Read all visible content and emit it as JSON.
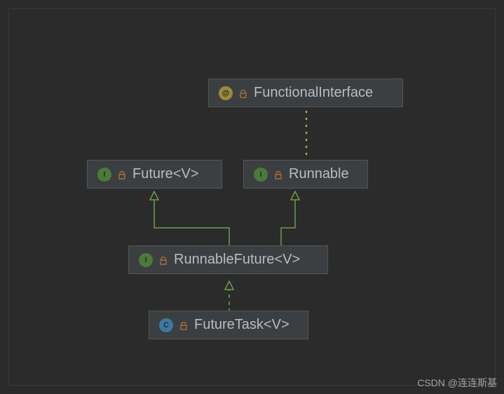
{
  "diagram": {
    "nodes": {
      "functionalInterface": {
        "label": "FunctionalInterface",
        "kind": "annotation"
      },
      "future": {
        "label": "Future<V>",
        "kind": "interface"
      },
      "runnable": {
        "label": "Runnable",
        "kind": "interface"
      },
      "runnableFuture": {
        "label": "RunnableFuture<V>",
        "kind": "interface"
      },
      "futureTask": {
        "label": "FutureTask<V>",
        "kind": "class"
      }
    },
    "iconGlyphs": {
      "interface": "I",
      "annotation": "@",
      "class": "C"
    },
    "edges": [
      {
        "from": "runnable",
        "to": "functionalInterface",
        "style": "dotted"
      },
      {
        "from": "runnableFuture",
        "to": "future",
        "style": "solid"
      },
      {
        "from": "runnableFuture",
        "to": "runnable",
        "style": "solid"
      },
      {
        "from": "futureTask",
        "to": "runnableFuture",
        "style": "dashed"
      }
    ],
    "colors": {
      "arrow": "#6e9c4e",
      "dotted": "#b7a84a"
    }
  },
  "watermark": "CSDN @连连斯基"
}
